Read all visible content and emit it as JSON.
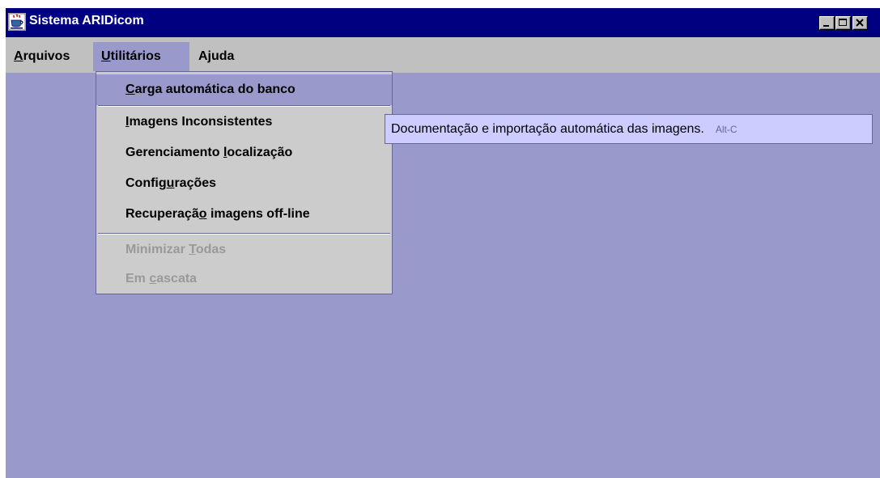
{
  "window": {
    "title": "Sistema ARIDicom"
  },
  "menubar": {
    "arquivos": {
      "accel": "A",
      "rest": "rquivos"
    },
    "utilitarios": {
      "accel": "U",
      "rest": "tilitários"
    },
    "ajuda": {
      "label": "Ajuda"
    }
  },
  "dropdown": {
    "items": [
      {
        "pre": "",
        "accel": "C",
        "post": "arga automática do banco",
        "state": "selected"
      },
      {
        "pre": "",
        "accel": "I",
        "post": "magens Inconsistentes",
        "state": "enabled"
      },
      {
        "pre": "Gerenciamento ",
        "accel": "l",
        "post": "ocalização",
        "state": "enabled"
      },
      {
        "pre": "Config",
        "accel": "u",
        "post": "rações",
        "state": "enabled"
      },
      {
        "pre": "Recuperaçã",
        "accel": "o",
        "post": " imagens off-line",
        "state": "enabled"
      },
      {
        "pre": "Minimizar ",
        "accel": "T",
        "post": "odas",
        "state": "disabled"
      },
      {
        "pre": "Em ",
        "accel": "c",
        "post": "ascata",
        "state": "disabled"
      }
    ]
  },
  "tooltip": {
    "text": "Documentação e importação automática das imagens.",
    "accelerator": "Alt-C"
  },
  "colors": {
    "titlebar": "#000080",
    "desktop": "#9999cc",
    "menu": "#cccccc",
    "tooltip": "#ccccff"
  }
}
